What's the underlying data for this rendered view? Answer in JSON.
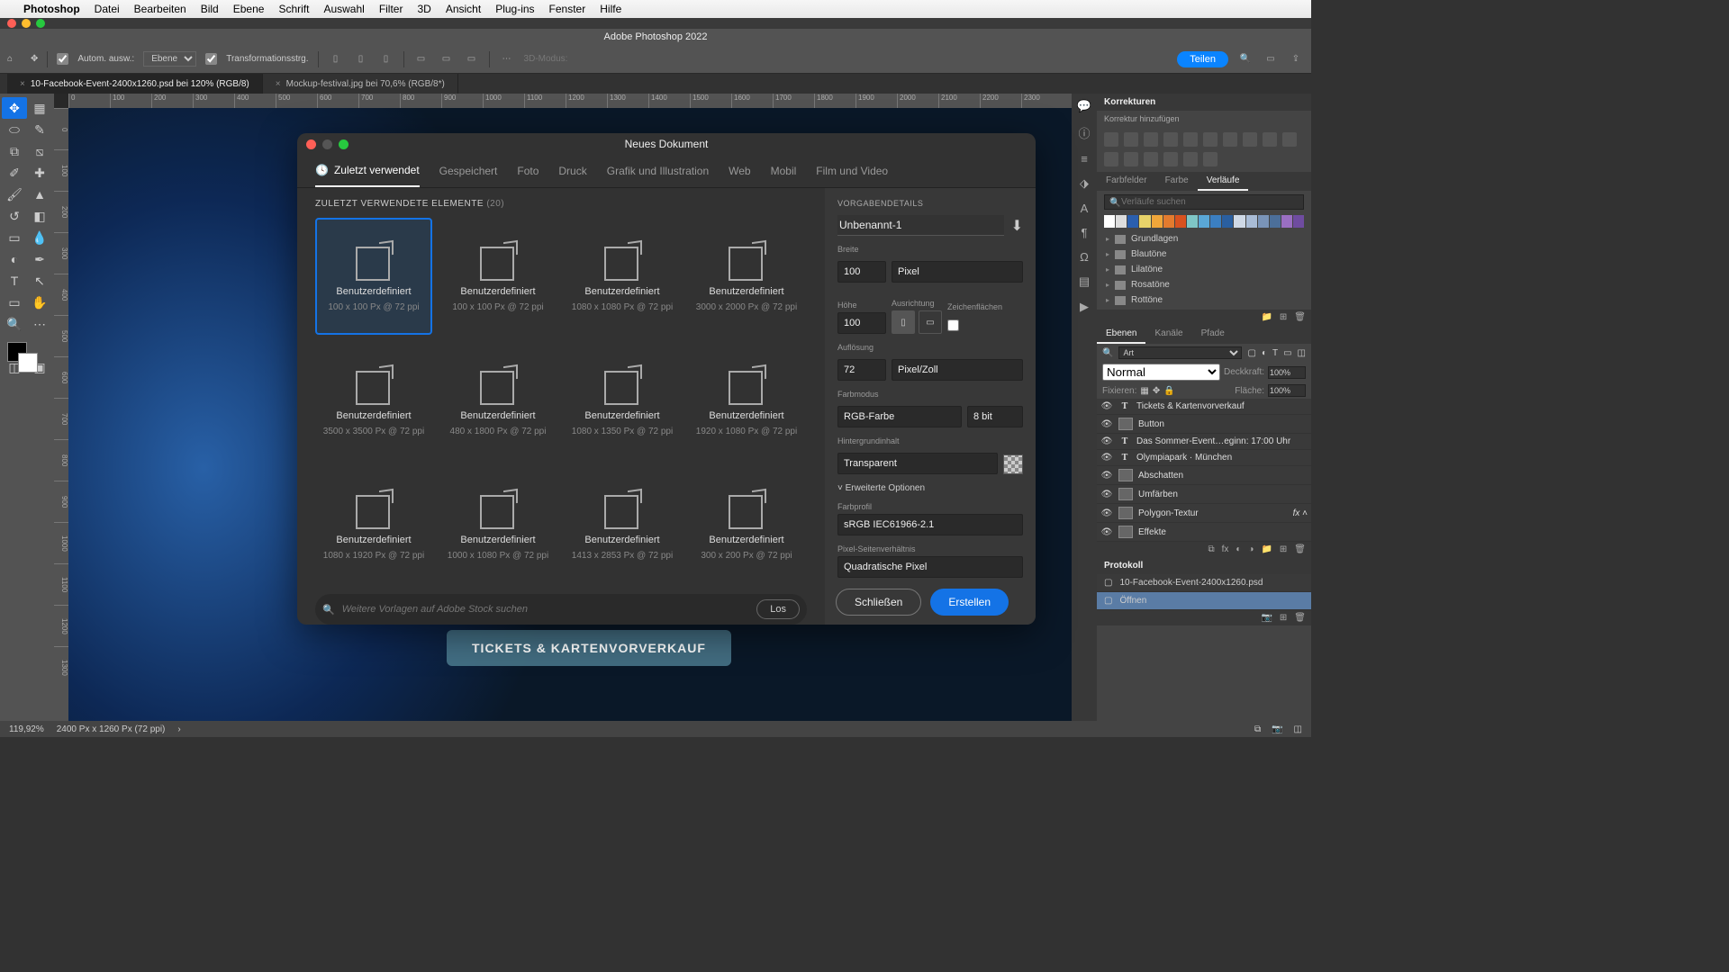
{
  "menubar": {
    "app": "Photoshop",
    "items": [
      "Datei",
      "Bearbeiten",
      "Bild",
      "Ebene",
      "Schrift",
      "Auswahl",
      "Filter",
      "3D",
      "Ansicht",
      "Plug-ins",
      "Fenster",
      "Hilfe"
    ]
  },
  "titlebar": "Adobe Photoshop 2022",
  "optbar": {
    "auto_select": "Autom. ausw.:",
    "layer_sel": "Ebene",
    "transform": "Transformationsstrg.",
    "mode3d": "3D-Modus:",
    "share": "Teilen"
  },
  "tabs": [
    {
      "name": "10-Facebook-Event-2400x1260.psd bei 120% (RGB/8)",
      "active": true
    },
    {
      "name": "Mockup-festival.jpg bei 70,6% (RGB/8*)",
      "active": false
    }
  ],
  "ruler_h": [
    "0",
    "100",
    "200",
    "300",
    "400",
    "500",
    "600",
    "700",
    "800",
    "900",
    "1000",
    "1100",
    "1200",
    "1300",
    "1400",
    "1500",
    "1600",
    "1700",
    "1800",
    "1900",
    "2000",
    "2100",
    "2200",
    "2300"
  ],
  "ruler_v": [
    "0",
    "100",
    "200",
    "300",
    "400",
    "500",
    "600",
    "700",
    "800",
    "900",
    "1000",
    "1100",
    "1200",
    "1300"
  ],
  "canvas": {
    "cta": "TICKETS & KARTENVORVERKAUF"
  },
  "panels": {
    "corrections": {
      "title": "Korrekturen",
      "hint": "Korrektur hinzufügen"
    },
    "color_tabs": [
      "Farbfelder",
      "Farbe",
      "Verläufe"
    ],
    "grad_search_ph": "Verläufe suchen",
    "grad_colors": [
      "#fff",
      "#ddd",
      "#2b5fae",
      "#e8d36a",
      "#f0a63a",
      "#e37b2e",
      "#d8521f",
      "#7fc6c6",
      "#5aa7d6",
      "#3b7fc2",
      "#2a5fa0",
      "#cfd9e6",
      "#a9bcd6",
      "#7a94b8",
      "#4c6f9a",
      "#9a6fc2",
      "#6f4ca0"
    ],
    "grad_folders": [
      "Grundlagen",
      "Blautöne",
      "Lilatöne",
      "Rosatöne",
      "Rottöne"
    ],
    "layer_tabs": [
      "Ebenen",
      "Kanäle",
      "Pfade"
    ],
    "layer_kind": "Art",
    "blend": "Normal",
    "blend_lbl": "",
    "opacity_lbl": "Deckkraft:",
    "opacity": "100%",
    "lock_lbl": "Fixieren:",
    "fill_lbl": "Fläche:",
    "fill": "100%",
    "layers": [
      {
        "type": "T",
        "name": "Tickets & Kartenvorverkauf"
      },
      {
        "type": "shape",
        "name": "Button"
      },
      {
        "type": "T",
        "name": "Das Sommer-Event…eginn: 17:00 Uhr"
      },
      {
        "type": "T",
        "name": "Olympiapark · München"
      },
      {
        "type": "fx",
        "name": "Abschatten"
      },
      {
        "type": "fx",
        "name": "Umfärben"
      },
      {
        "type": "smart",
        "name": "Polygon-Textur",
        "fx": true
      },
      {
        "type": "sub",
        "name": "Effekte"
      }
    ],
    "history": {
      "title": "Protokoll",
      "items": [
        {
          "name": "10-Facebook-Event-2400x1260.psd",
          "sel": false
        },
        {
          "name": "Öffnen",
          "sel": true
        }
      ]
    }
  },
  "dialog": {
    "title": "Neues Dokument",
    "tabs": [
      "Zuletzt verwendet",
      "Gespeichert",
      "Foto",
      "Druck",
      "Grafik und Illustration",
      "Web",
      "Mobil",
      "Film und Video"
    ],
    "active_tab": 0,
    "section": "ZULETZT VERWENDETE ELEMENTE",
    "count": "(20)",
    "presets": [
      {
        "name": "Benutzerdefiniert",
        "dim": "100 x 100 Px @ 72 ppi",
        "sel": true
      },
      {
        "name": "Benutzerdefiniert",
        "dim": "100 x 100 Px @ 72 ppi"
      },
      {
        "name": "Benutzerdefiniert",
        "dim": "1080 x 1080 Px @ 72 ppi"
      },
      {
        "name": "Benutzerdefiniert",
        "dim": "3000 x 2000 Px @ 72 ppi"
      },
      {
        "name": "Benutzerdefiniert",
        "dim": "3500 x 3500 Px @ 72 ppi"
      },
      {
        "name": "Benutzerdefiniert",
        "dim": "480 x 1800 Px @ 72 ppi"
      },
      {
        "name": "Benutzerdefiniert",
        "dim": "1080 x 1350 Px @ 72 ppi"
      },
      {
        "name": "Benutzerdefiniert",
        "dim": "1920 x 1080 Px @ 72 ppi"
      },
      {
        "name": "Benutzerdefiniert",
        "dim": "1080 x 1920 Px @ 72 ppi"
      },
      {
        "name": "Benutzerdefiniert",
        "dim": "1000 x 1080 Px @ 72 ppi"
      },
      {
        "name": "Benutzerdefiniert",
        "dim": "1413 x 2853 Px @ 72 ppi"
      },
      {
        "name": "Benutzerdefiniert",
        "dim": "300 x 200 Px @ 72 ppi"
      }
    ],
    "search_ph": "Weitere Vorlagen auf Adobe Stock suchen",
    "search_btn": "Los",
    "details": {
      "title": "VORGABENDETAILS",
      "name": "Unbenannt-1",
      "width_lbl": "Breite",
      "width": "100",
      "width_unit": "Pixel",
      "height_lbl": "Höhe",
      "height": "100",
      "orient_lbl": "Ausrichtung",
      "artboard_lbl": "Zeichenflächen",
      "res_lbl": "Auflösung",
      "res": "72",
      "res_unit": "Pixel/Zoll",
      "colormode_lbl": "Farbmodus",
      "colormode": "RGB-Farbe",
      "colordepth": "8 bit",
      "bg_lbl": "Hintergrundinhalt",
      "bg": "Transparent",
      "advanced": "Erweiterte Optionen",
      "profile_lbl": "Farbprofil",
      "profile": "sRGB IEC61966-2.1",
      "aspect_lbl": "Pixel-Seitenverhältnis",
      "aspect": "Quadratische Pixel"
    },
    "close": "Schließen",
    "create": "Erstellen"
  },
  "status": {
    "zoom": "119,92%",
    "dims": "2400 Px x 1260 Px (72 ppi)"
  }
}
